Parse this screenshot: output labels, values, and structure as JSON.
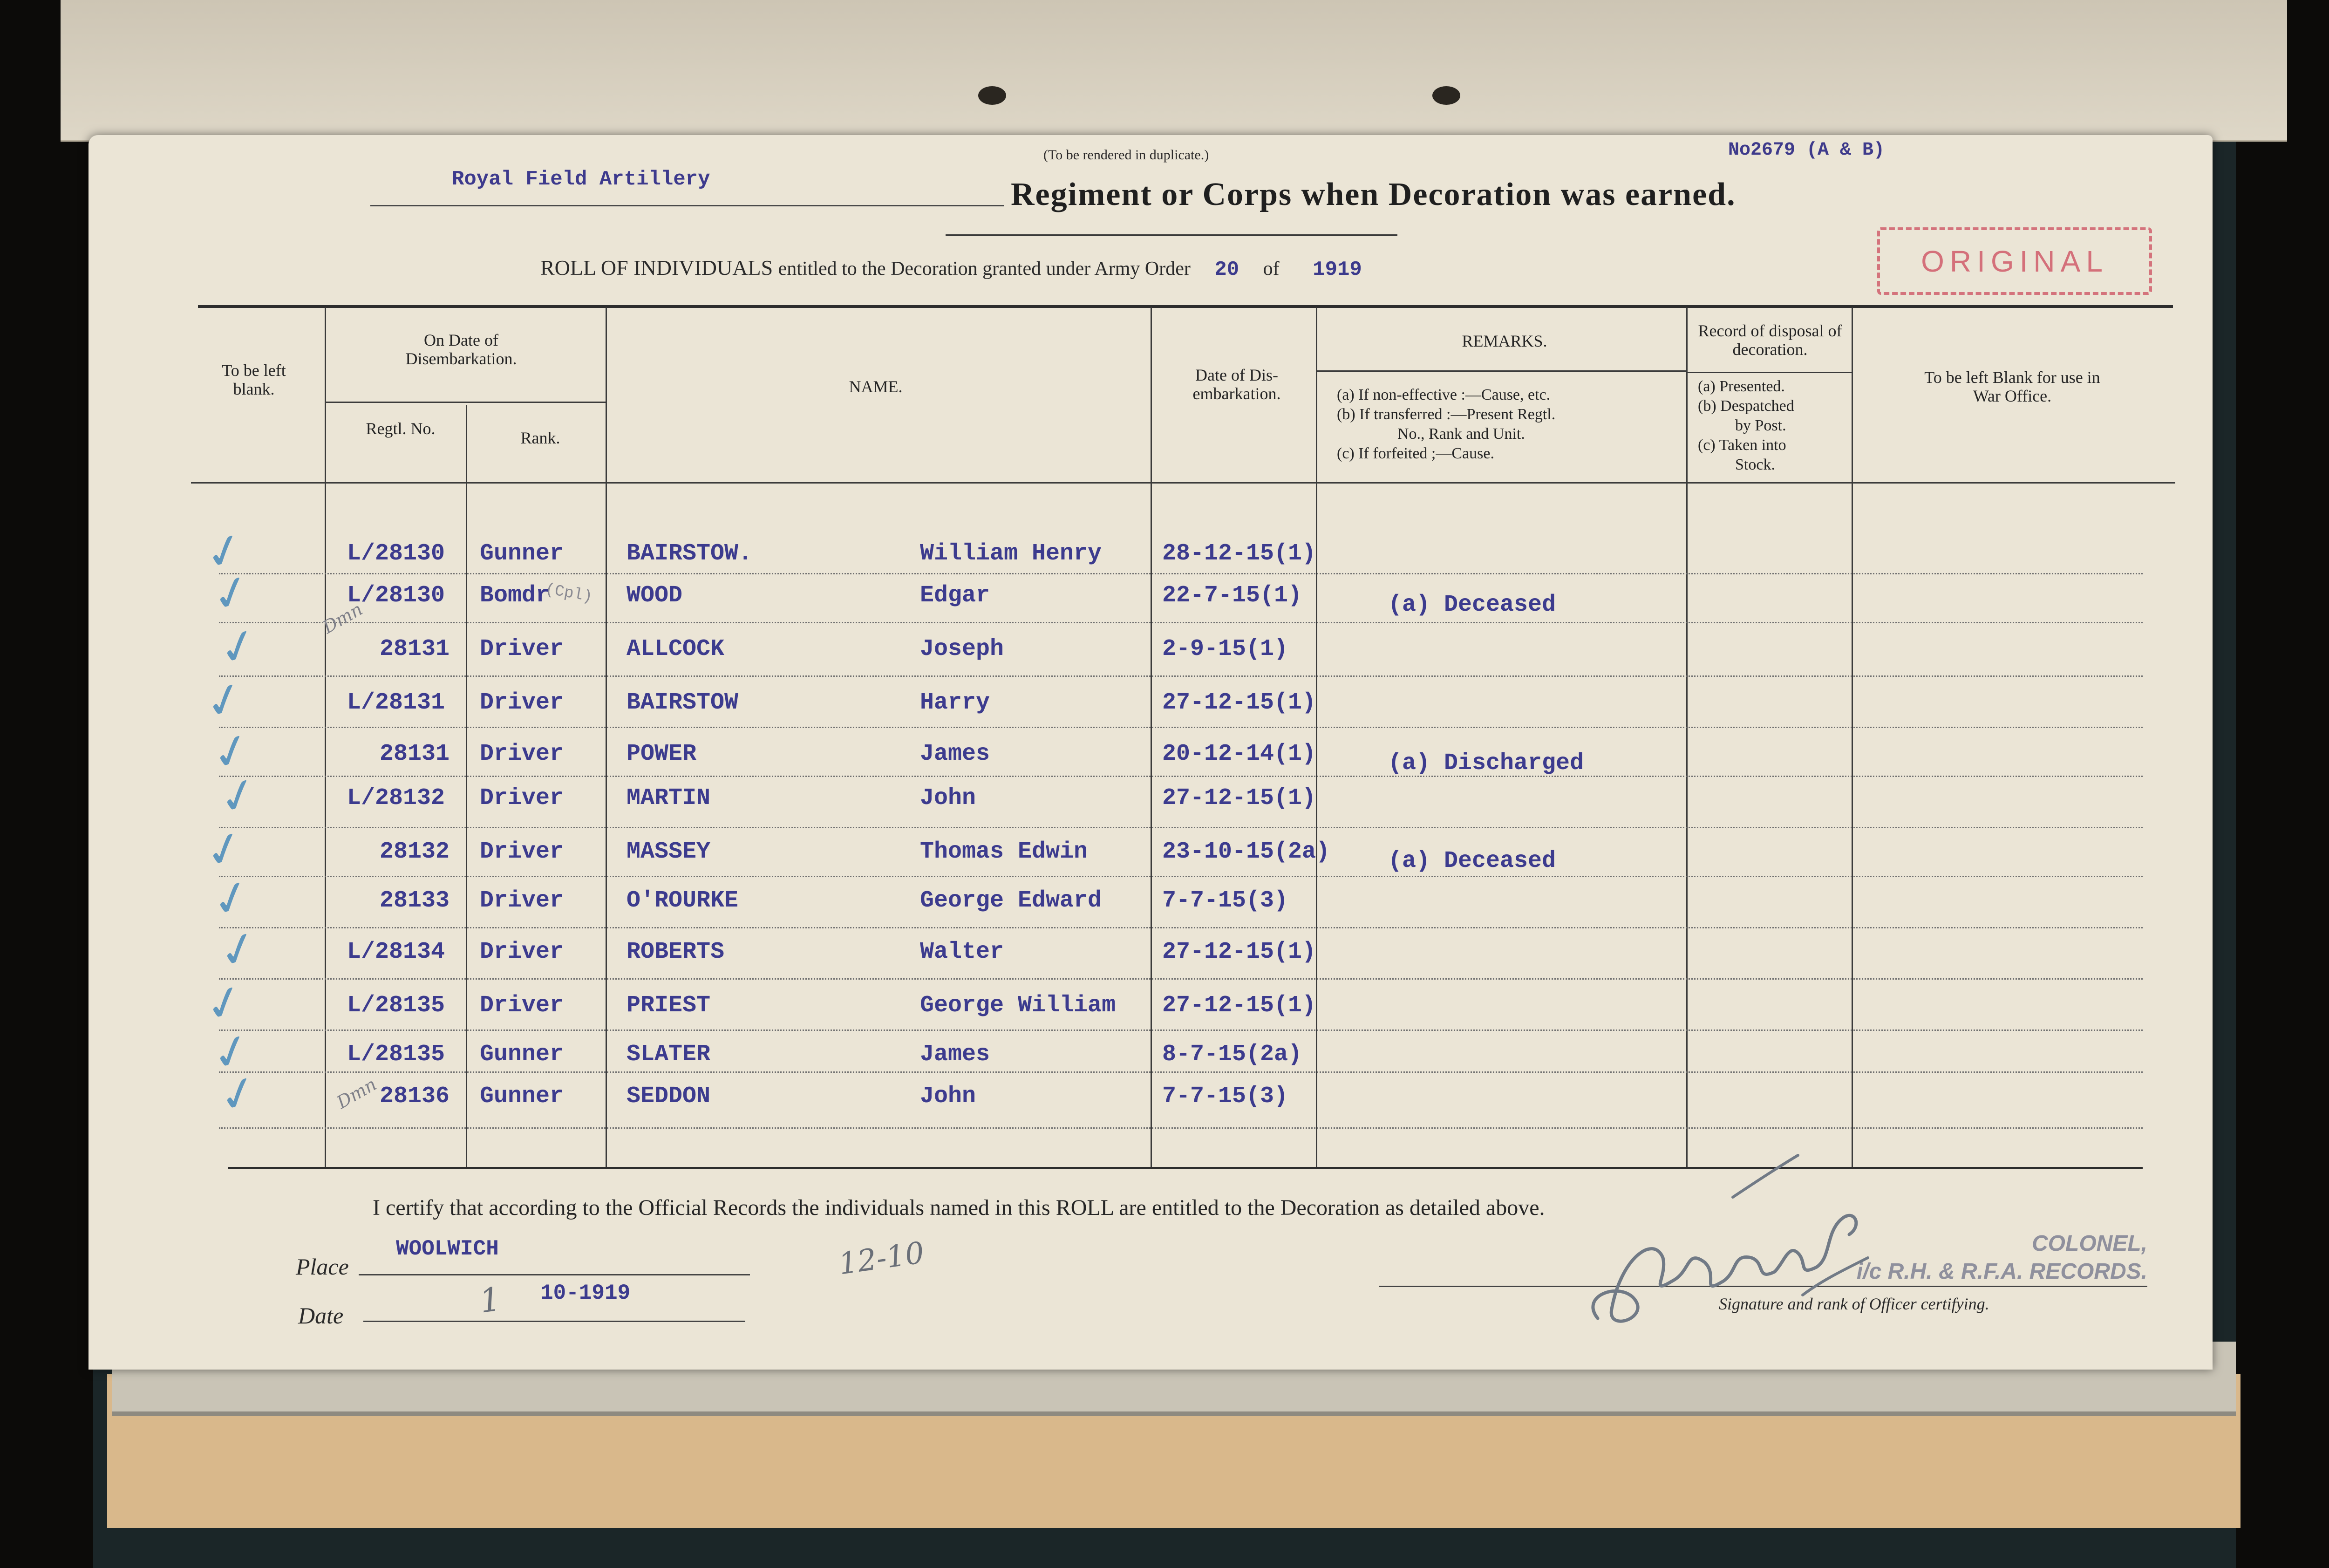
{
  "header": {
    "duplicate_note": "(To be rendered in duplicate.)",
    "reference_no": "No2679 (A & B)",
    "regiment_value": "Royal Field Artillery",
    "regiment_heading": "Regiment or Corps when Decoration was earned.",
    "stamp_text": "ORIGINAL",
    "roll_prefix": "ROLL OF INDIVIDUALS",
    "roll_middle": "entitled to the Decoration granted under Army Order",
    "army_order_no": "20",
    "of_text": "of",
    "army_order_year": "1919"
  },
  "columns": {
    "blank": "To be left blank.",
    "disembarkation_group": "On Date of Disembarkation.",
    "regtl_no": "Regtl. No.",
    "rank": "Rank.",
    "name": "NAME.",
    "date_disembarkation": "Date of Dis- embarkation.",
    "remarks": "REMARKS.",
    "remarks_a": "(a) If non-effective :—Cause, etc.",
    "remarks_b": "(b) If transferred :—Present Regtl.",
    "remarks_b2": "No., Rank and Unit.",
    "remarks_c": "(c) If forfeited ;—Cause.",
    "disposal_heading": "Record of disposal of decoration.",
    "disposal_a": "(a) Presented.",
    "disposal_b": "(b) Despatched",
    "disposal_b2": "by Post.",
    "disposal_c": "(c) Taken into",
    "disposal_c2": "Stock.",
    "war_office": "To be left Blank for use in War Office."
  },
  "rows": [
    {
      "regtl_no": "L/28130",
      "rank": "Gunner",
      "surname": "BAIRSTOW.",
      "forenames": "William Henry",
      "date": "28-12-15(1)",
      "remarks": ""
    },
    {
      "regtl_no": "L/28130",
      "rank": "Bomdr",
      "surname": "WOOD",
      "forenames": "Edgar",
      "date": "22-7-15(1)",
      "remarks": "(a) Deceased"
    },
    {
      "regtl_no": "28131",
      "rank": "Driver",
      "surname": "ALLCOCK",
      "forenames": "Joseph",
      "date": "2-9-15(1)",
      "remarks": ""
    },
    {
      "regtl_no": "L/28131",
      "rank": "Driver",
      "surname": "BAIRSTOW",
      "forenames": "Harry",
      "date": "27-12-15(1)",
      "remarks": ""
    },
    {
      "regtl_no": "28131",
      "rank": "Driver",
      "surname": "POWER",
      "forenames": "James",
      "date": "20-12-14(1)",
      "remarks": "(a) Discharged"
    },
    {
      "regtl_no": "L/28132",
      "rank": "Driver",
      "surname": "MARTIN",
      "forenames": "John",
      "date": "27-12-15(1)",
      "remarks": ""
    },
    {
      "regtl_no": "28132",
      "rank": "Driver",
      "surname": "MASSEY",
      "forenames": "Thomas Edwin",
      "date": "23-10-15(2a)",
      "remarks": "(a) Deceased"
    },
    {
      "regtl_no": "28133",
      "rank": "Driver",
      "surname": "O'ROURKE",
      "forenames": "George Edward",
      "date": "7-7-15(3)",
      "remarks": ""
    },
    {
      "regtl_no": "L/28134",
      "rank": "Driver",
      "surname": "ROBERTS",
      "forenames": "Walter",
      "date": "27-12-15(1)",
      "remarks": ""
    },
    {
      "regtl_no": "L/28135",
      "rank": "Driver",
      "surname": "PRIEST",
      "forenames": "George William",
      "date": "27-12-15(1)",
      "remarks": ""
    },
    {
      "regtl_no": "L/28135",
      "rank": "Gunner",
      "surname": "SLATER",
      "forenames": "James",
      "date": "8-7-15(2a)",
      "remarks": ""
    },
    {
      "regtl_no": "28136",
      "rank": "Gunner",
      "surname": "SEDDON",
      "forenames": "John",
      "date": "7-7-15(3)",
      "remarks": ""
    }
  ],
  "tick_glyph": "✓",
  "annotations": {
    "bomdr_note": "(Cpl)",
    "margin_note_1": "Dmn",
    "margin_note_2": "Dmn"
  },
  "footer": {
    "certify": "I certify that according to the Official Records the individuals named in this ROLL are entitled to the Decoration as detailed above.",
    "place_label": "Place",
    "place_value": "WOOLWICH",
    "date_label": "Date",
    "date_day": "1",
    "date_value": "10-1919",
    "handwritten_note": "12-10",
    "colonel_stamp_1": "COLONEL,",
    "colonel_stamp_2": "i/c R.H. & R.F.A. RECORDS.",
    "signature_label": "Signature and rank of Officer certifying."
  },
  "colors": {
    "typed_ink": "#3c3b8e",
    "tick_ink": "#5f97be",
    "stamp_red": "#d4707a",
    "paper": "#ebe5d6"
  }
}
